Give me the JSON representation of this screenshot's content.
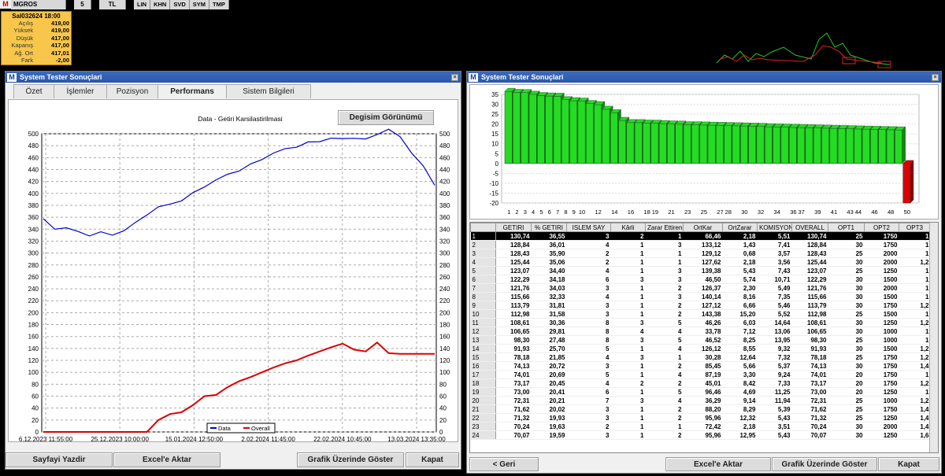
{
  "topbar": {
    "symbol": "MGROS",
    "period": "5",
    "currency": "TL",
    "tools": [
      "LIN",
      "KHN",
      "SVD",
      "SYM",
      "TMP"
    ]
  },
  "quote": {
    "header": "Sal032624 18:00",
    "rows": [
      {
        "label": "Açılış",
        "value": "419,00"
      },
      {
        "label": "Yüksek",
        "value": "419,00"
      },
      {
        "label": "Düşük",
        "value": "417,00"
      },
      {
        "label": "Kapanış",
        "value": "417,00"
      },
      {
        "label": "Ağ. Ort",
        "value": "417,01"
      },
      {
        "label": "Fark",
        "value": "-2,00"
      }
    ]
  },
  "left_window": {
    "title": "System Tester Sonuçlari",
    "tabs": [
      "Özet",
      "İşlemler",
      "Pozisyon",
      "Performans",
      "Sistem Bilgileri"
    ],
    "active_tab": "Performans",
    "view_button": "Degisim Görünümü",
    "buttons": [
      "Sayfayi Yazdir",
      "Excel'e Aktar",
      "Grafik Üzerinde Göster",
      "Kapat"
    ]
  },
  "right_window": {
    "title": "System Tester Sonuçlari",
    "buttons": [
      "< Geri",
      "Excel'e Aktar",
      "Grafik Üzerinde Göster",
      "Kapat"
    ]
  },
  "chart_data": [
    {
      "type": "line",
      "title": "Data - Getiri Karsilastirilmasi",
      "x_tick_labels": [
        "6.12.2023 11:55:00",
        "25.12.2023 10:00:00",
        "15.01.2024 12:50:00",
        "2.02.2024 11:45:00",
        "22.02.2024 10:45:00",
        "13.03.2024 13:35:00"
      ],
      "y_ticks": [
        0,
        20,
        40,
        60,
        80,
        100,
        120,
        140,
        160,
        180,
        200,
        220,
        240,
        260,
        280,
        300,
        320,
        340,
        360,
        380,
        400,
        420,
        440,
        460,
        480,
        500
      ],
      "ylim": [
        0,
        500
      ],
      "grid": true,
      "legend": "bottom-center",
      "series": [
        {
          "name": "Data",
          "color": "#0000cc",
          "values": [
            355,
            340,
            345,
            335,
            330,
            333,
            330,
            340,
            350,
            365,
            375,
            382,
            390,
            400,
            412,
            420,
            432,
            440,
            448,
            458,
            465,
            475,
            480,
            485,
            488,
            490,
            492,
            495,
            490,
            500,
            505,
            495,
            470,
            445,
            415
          ]
        },
        {
          "name": "Overall",
          "color": "#dd0000",
          "values": [
            0,
            0,
            0,
            0,
            0,
            0,
            0,
            0,
            0,
            0,
            20,
            30,
            33,
            45,
            60,
            62,
            75,
            85,
            92,
            100,
            108,
            115,
            120,
            128,
            135,
            142,
            148,
            138,
            135,
            150,
            132,
            131,
            131,
            131,
            131
          ]
        }
      ]
    },
    {
      "type": "bar",
      "y_ticks": [
        35,
        30,
        25,
        20,
        15,
        10,
        5,
        0,
        -5,
        -10,
        -15,
        -20
      ],
      "ylim": [
        -20,
        35
      ],
      "x_tick_labels": [
        "1",
        "2",
        "3",
        "4",
        "5",
        "6",
        "7",
        "8",
        "9",
        "10",
        "12",
        "14",
        "16",
        "18",
        "19",
        "21",
        "23",
        "25",
        "27",
        "28",
        "30",
        "32",
        "34",
        "36",
        "37",
        "39",
        "41",
        "43",
        "44",
        "46",
        "48",
        "50"
      ],
      "values": [
        36.55,
        36.01,
        35.9,
        35.06,
        34.4,
        34.18,
        34.03,
        32.33,
        31.81,
        31.58,
        30.36,
        29.81,
        27.48,
        25.7,
        21.85,
        20.72,
        20.69,
        20.45,
        20.41,
        20.21,
        20.02,
        19.93,
        19.63,
        19.59,
        19.5,
        19.4,
        19.3,
        19.2,
        19.1,
        19.0,
        18.9,
        18.8,
        18.6,
        18.5,
        18.4,
        18.3,
        18.2,
        18.1,
        18.0,
        17.9,
        17.8,
        17.7,
        17.6,
        17.5,
        17.4,
        17.3,
        17.2,
        17.1,
        17.0,
        -20.0
      ],
      "colors": {
        "positive": "#22dd22",
        "negative": "#dd0000"
      }
    }
  ],
  "results_table": {
    "columns": [
      "GETIRI",
      "% GETIRI",
      "ISLEM SAY",
      "Kârli",
      "Zarar Ettiren",
      "OrtKar",
      "OrtZarar",
      "KOMISYON",
      "OVERALL",
      "OPT1",
      "OPT2",
      "OPT3"
    ],
    "rows": [
      [
        "1",
        "130,74",
        "36,55",
        "3",
        "2",
        "1",
        "66,46",
        "2,18",
        "5,51",
        "130,74",
        "25",
        "1750",
        "1"
      ],
      [
        "2",
        "128,84",
        "36,01",
        "4",
        "1",
        "3",
        "133,12",
        "1,43",
        "7,41",
        "128,84",
        "30",
        "1750",
        "1"
      ],
      [
        "3",
        "128,43",
        "35,90",
        "2",
        "1",
        "1",
        "129,12",
        "0,68",
        "3,57",
        "128,43",
        "25",
        "2000",
        "1"
      ],
      [
        "4",
        "125,44",
        "35,06",
        "2",
        "1",
        "1",
        "127,62",
        "2,18",
        "3,56",
        "125,44",
        "30",
        "2000",
        "1,2"
      ],
      [
        "5",
        "123,07",
        "34,40",
        "4",
        "1",
        "3",
        "139,38",
        "5,43",
        "7,43",
        "123,07",
        "25",
        "1250",
        "1"
      ],
      [
        "6",
        "122,29",
        "34,18",
        "6",
        "3",
        "3",
        "46,50",
        "5,74",
        "10,71",
        "122,29",
        "30",
        "1500",
        "1"
      ],
      [
        "7",
        "121,76",
        "34,03",
        "3",
        "1",
        "2",
        "126,37",
        "2,30",
        "5,49",
        "121,76",
        "30",
        "2000",
        "1"
      ],
      [
        "8",
        "115,66",
        "32,33",
        "4",
        "1",
        "3",
        "140,14",
        "8,16",
        "7,35",
        "115,66",
        "30",
        "1500",
        "1"
      ],
      [
        "9",
        "113,79",
        "31,81",
        "3",
        "1",
        "2",
        "127,12",
        "6,66",
        "5,46",
        "113,79",
        "30",
        "1750",
        "1,2"
      ],
      [
        "10",
        "112,98",
        "31,58",
        "3",
        "1",
        "2",
        "143,38",
        "15,20",
        "5,52",
        "112,98",
        "25",
        "1500",
        "1"
      ],
      [
        "11",
        "108,61",
        "30,36",
        "8",
        "3",
        "5",
        "46,26",
        "6,03",
        "14,64",
        "108,61",
        "30",
        "1250",
        "1,2"
      ],
      [
        "12",
        "106,65",
        "29,81",
        "8",
        "4",
        "4",
        "33,78",
        "7,12",
        "13,06",
        "106,65",
        "30",
        "1000",
        "1"
      ],
      [
        "13",
        "98,30",
        "27,48",
        "8",
        "3",
        "5",
        "46,52",
        "8,25",
        "13,95",
        "98,30",
        "25",
        "1000",
        "1"
      ],
      [
        "14",
        "91,93",
        "25,70",
        "5",
        "1",
        "4",
        "126,12",
        "8,55",
        "9,32",
        "91,93",
        "30",
        "1500",
        "1,2"
      ],
      [
        "15",
        "78,18",
        "21,85",
        "4",
        "3",
        "1",
        "30,28",
        "12,64",
        "7,32",
        "78,18",
        "25",
        "1750",
        "1,2"
      ],
      [
        "16",
        "74,13",
        "20,72",
        "3",
        "1",
        "2",
        "85,45",
        "5,66",
        "5,37",
        "74,13",
        "30",
        "1750",
        "1,4"
      ],
      [
        "17",
        "74,01",
        "20,69",
        "5",
        "1",
        "4",
        "87,19",
        "3,30",
        "9,24",
        "74,01",
        "20",
        "1750",
        "1"
      ],
      [
        "18",
        "73,17",
        "20,45",
        "4",
        "2",
        "2",
        "45,01",
        "8,42",
        "7,33",
        "73,17",
        "20",
        "1750",
        "1,2"
      ],
      [
        "19",
        "73,00",
        "20,41",
        "6",
        "1",
        "5",
        "96,46",
        "4,69",
        "11,25",
        "73,00",
        "20",
        "1250",
        "1"
      ],
      [
        "20",
        "72,31",
        "20,21",
        "7",
        "3",
        "4",
        "36,29",
        "9,14",
        "11,94",
        "72,31",
        "25",
        "1000",
        "1,2"
      ],
      [
        "21",
        "71,62",
        "20,02",
        "3",
        "1",
        "2",
        "88,20",
        "8,29",
        "5,39",
        "71,62",
        "25",
        "1750",
        "1,4"
      ],
      [
        "22",
        "71,32",
        "19,93",
        "3",
        "1",
        "2",
        "95,96",
        "12,32",
        "5,43",
        "71,32",
        "25",
        "1250",
        "1,4"
      ],
      [
        "23",
        "70,24",
        "19,63",
        "2",
        "1",
        "1",
        "72,42",
        "2,18",
        "3,51",
        "70,24",
        "30",
        "2000",
        "1,4"
      ],
      [
        "24",
        "70,07",
        "19,59",
        "3",
        "1",
        "2",
        "95,96",
        "12,95",
        "5,43",
        "70,07",
        "30",
        "1250",
        "1,6"
      ]
    ]
  }
}
